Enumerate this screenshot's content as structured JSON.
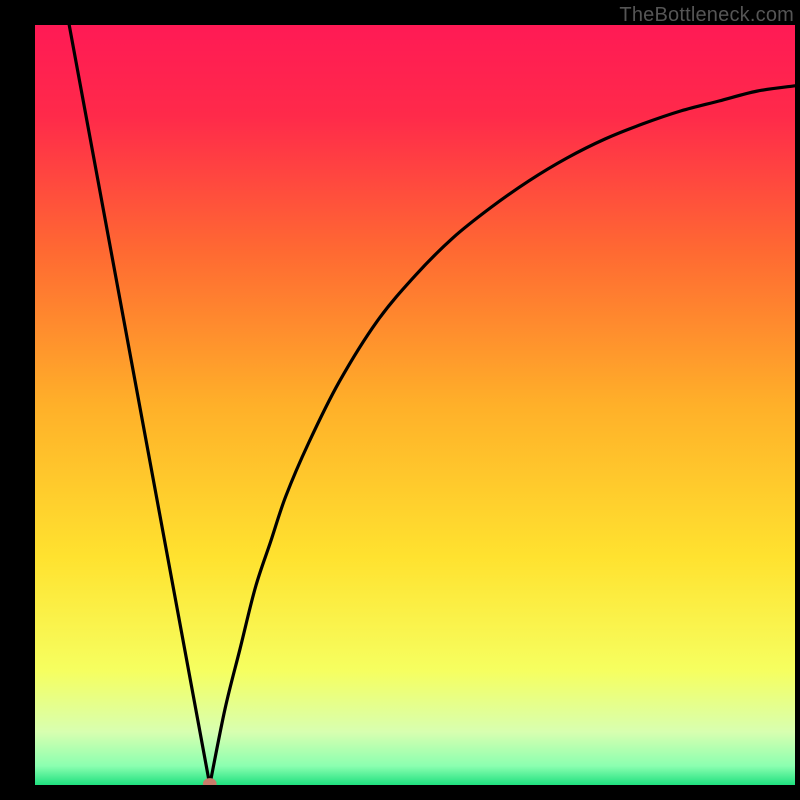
{
  "watermark": "TheBottleneck.com",
  "chart_data": {
    "type": "line",
    "title": "",
    "xlabel": "",
    "ylabel": "",
    "xlim": [
      0,
      100
    ],
    "ylim": [
      0,
      100
    ],
    "gradient_stops": [
      {
        "offset": 0,
        "color": "#ff1a55"
      },
      {
        "offset": 0.12,
        "color": "#ff2a4a"
      },
      {
        "offset": 0.3,
        "color": "#ff6a32"
      },
      {
        "offset": 0.5,
        "color": "#ffb029"
      },
      {
        "offset": 0.7,
        "color": "#ffe22f"
      },
      {
        "offset": 0.85,
        "color": "#f6ff60"
      },
      {
        "offset": 0.93,
        "color": "#d8ffb0"
      },
      {
        "offset": 0.975,
        "color": "#8bffb0"
      },
      {
        "offset": 1.0,
        "color": "#1fe07f"
      }
    ],
    "series": [
      {
        "name": "left-branch",
        "x": [
          4.5,
          23.0
        ],
        "y": [
          100,
          0
        ]
      },
      {
        "name": "right-branch",
        "x": [
          23.0,
          25,
          27,
          29,
          31,
          33,
          36,
          40,
          45,
          50,
          55,
          60,
          65,
          70,
          75,
          80,
          85,
          90,
          95,
          100
        ],
        "y": [
          0,
          10,
          18,
          26,
          32,
          38,
          45,
          53,
          61,
          67,
          72,
          76,
          79.5,
          82.5,
          85,
          87,
          88.7,
          90,
          91.3,
          92
        ]
      }
    ],
    "marker": {
      "x": 23.0,
      "y": 0.2,
      "rx": 0.9,
      "ry": 0.7,
      "color": "#c97b6a"
    }
  }
}
